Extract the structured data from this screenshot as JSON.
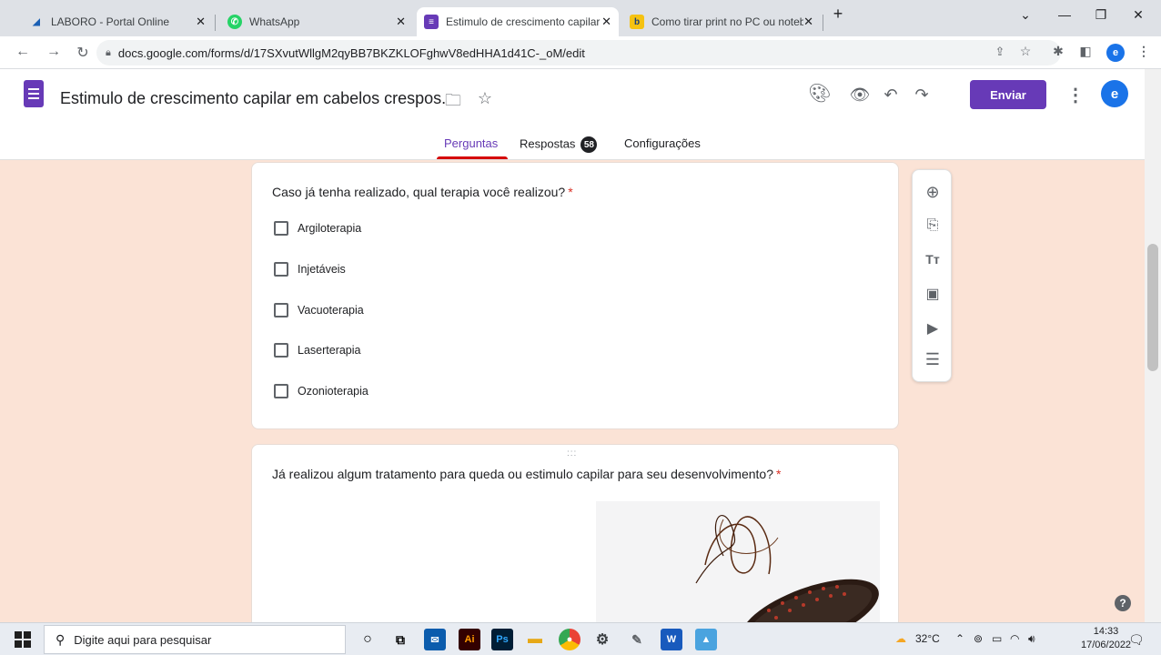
{
  "browser": {
    "tabs": [
      {
        "title": "LABORO - Portal Online",
        "icon": "laboro-icon",
        "color": "#1a5fb4"
      },
      {
        "title": "WhatsApp",
        "icon": "whatsapp-icon",
        "color": "#25d366"
      },
      {
        "title": "Estimulo de crescimento capilar e",
        "icon": "google-forms-icon",
        "color": "#673ab7"
      },
      {
        "title": "Como tirar print no PC ou notebo",
        "icon": "bing-icon",
        "color": "#f5c211"
      }
    ],
    "new_tab": "+",
    "url": "docs.google.com/forms/d/17SXvutWllgM2qyBB7BKZKLOFghwV8edHHA1d41C-_oM/edit",
    "profile_initial": "e"
  },
  "form": {
    "title": "Estimulo de crescimento capilar em cabelos crespos.",
    "send_label": "Enviar",
    "avatar_initial": "e",
    "tabs": {
      "questions": "Perguntas",
      "responses": "Respostas",
      "responses_count": "58",
      "settings": "Configurações"
    },
    "accent": "#673ab7"
  },
  "question1": {
    "title": "Caso já tenha realizado, qual terapia você realizou?",
    "required_mark": "*",
    "options": [
      "Argiloterapia",
      "Injetáveis",
      "Vacuoterapia",
      "Laserterapia",
      "Ozonioterapia"
    ]
  },
  "question2": {
    "title": "Já realizou algum tratamento para queda ou estimulo capilar para seu desenvolvimento?",
    "required_mark": "*",
    "drag_handle": ":::"
  },
  "taskbar": {
    "search_placeholder": "Digite aqui para pesquisar",
    "weather": "32°C",
    "time": "14:33",
    "date": "17/06/2022"
  }
}
